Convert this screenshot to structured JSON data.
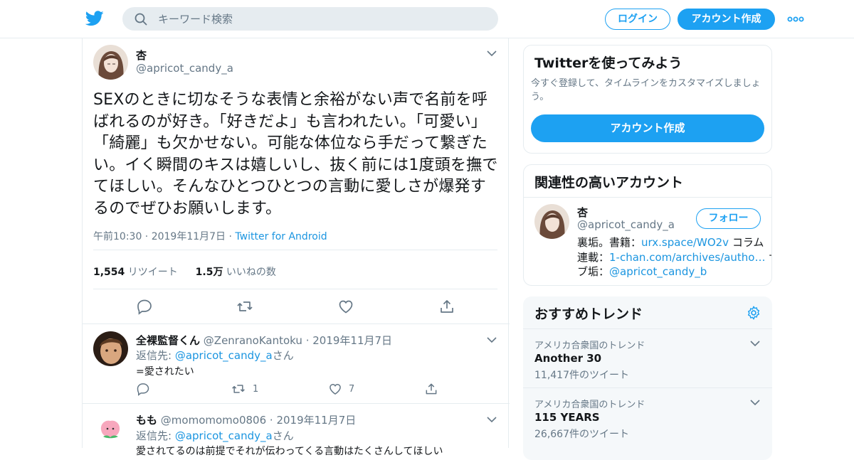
{
  "header": {
    "search_placeholder": "キーワード検索",
    "login_label": "ログイン",
    "signup_label": "アカウント作成"
  },
  "tweet": {
    "name": "杏",
    "handle": "@apricot_candy_a",
    "text": "SEXのときに切なそうな表情と余裕がない声で名前を呼ばれるのが好き。「好きだよ」も言われたい。「可愛い」「綺麗」も欠かせない。可能な体位なら手だって繋ぎたい。イく瞬間のキスは嬉しいし、抜く前には1度頭を撫でてほしい。そんなひとつひとつの言動に愛しさが爆発するのでぜひお願いします。",
    "time": "午前10:30 · 2019年11月7日 · ",
    "source": "Twitter for Android",
    "retweets": "1,554",
    "retweets_label": "リツイート",
    "likes": "1.5万",
    "likes_label": "いいねの数"
  },
  "replies": [
    {
      "name": "全裸監督くん",
      "handle": "@ZenranoKantoku",
      "date": "· 2019年11月7日",
      "to_prefix": "返信先: ",
      "to_handle": "@apricot_candy_a",
      "to_suffix": "さん",
      "text": "=愛されたい",
      "retweets": "1",
      "likes": "7"
    },
    {
      "name": "もも",
      "handle": "@momomomo0806",
      "date": "· 2019年11月7日",
      "to_prefix": "返信先: ",
      "to_handle": "@apricot_candy_a",
      "to_suffix": "さん",
      "text": "愛されてるのは前提でそれが伝わってくる言動はたくさんしてほしい"
    }
  ],
  "sidebar": {
    "promo_title": "Twitterを使ってみよう",
    "promo_text": "今すぐ登録して、タイムラインをカスタマイズしましょう。",
    "promo_button": "アカウント作成",
    "related_title": "関連性の高いアカウント",
    "related": {
      "name": "杏",
      "handle": "@apricot_candy_a",
      "follow_label": "フォロー",
      "bio_1a": "裏垢。書籍：",
      "bio_1b": "urx.space/WO2v",
      "bio_1c": " コラム",
      "bio_2a": "連載：",
      "bio_2b": "1-chan.com/archives/autho…",
      "bio_2c": " サ",
      "bio_3a": "ブ垢：",
      "bio_3b": "@apricot_candy_b"
    },
    "trends_title": "おすすめトレンド",
    "trends": [
      {
        "location": "アメリカ合衆国のトレンド",
        "name": "Another 30",
        "count": "11,417件のツイート"
      },
      {
        "location": "アメリカ合衆国のトレンド",
        "name": "115 YEARS",
        "count": "26,667件のツイート"
      }
    ]
  },
  "colors": {
    "accent": "#1da1f2",
    "link": "#1b95e0",
    "secondary_text": "#657786",
    "border": "#e6ecf0"
  }
}
